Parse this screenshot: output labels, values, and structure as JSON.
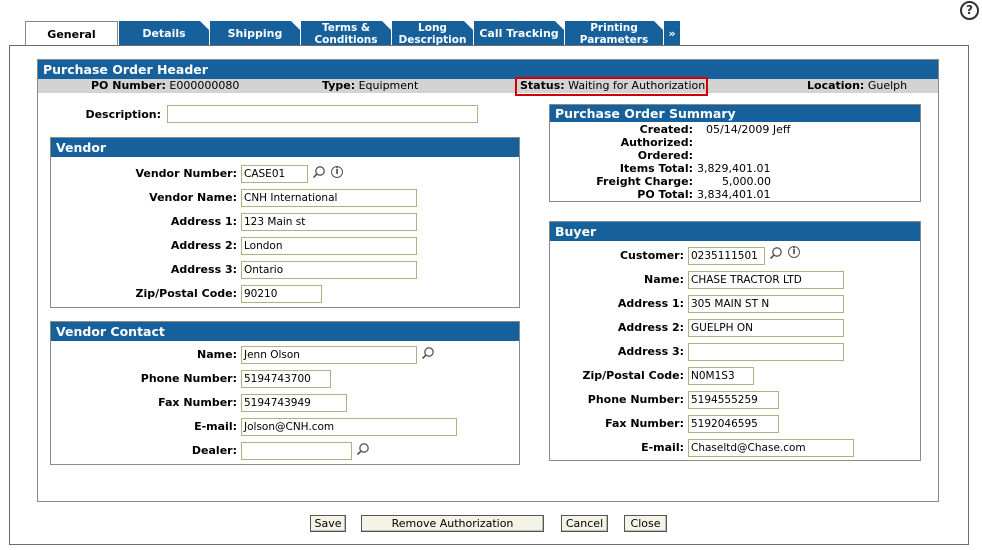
{
  "help_symbol": "?",
  "tabs": [
    {
      "l1": "General",
      "l2": ""
    },
    {
      "l1": "Details",
      "l2": ""
    },
    {
      "l1": "Shipping",
      "l2": ""
    },
    {
      "l1": "Terms &",
      "l2": "Conditions"
    },
    {
      "l1": "Long",
      "l2": "Description"
    },
    {
      "l1": "Call Tracking",
      "l2": ""
    },
    {
      "l1": "Printing",
      "l2": "Parameters"
    },
    {
      "l1": "»",
      "l2": ""
    }
  ],
  "header": {
    "title": "Purchase Order Header",
    "po_label": "PO Number:",
    "po_value": "E000000080",
    "type_label": "Type:",
    "type_value": "Equipment",
    "status_label": "Status:",
    "status_value": "Waiting for Authorization",
    "location_label": "Location:",
    "location_value": "Guelph"
  },
  "description": {
    "label": "Description:",
    "value": ""
  },
  "vendor": {
    "title": "Vendor",
    "number_label": "Vendor Number:",
    "number_value": "CASE01",
    "name_label": "Vendor Name:",
    "name_value": "CNH International",
    "addr1_label": "Address 1:",
    "addr1_value": "123 Main st",
    "addr2_label": "Address 2:",
    "addr2_value": "London",
    "addr3_label": "Address 3:",
    "addr3_value": "Ontario",
    "zip_label": "Zip/Postal Code:",
    "zip_value": "90210"
  },
  "vendor_contact": {
    "title": "Vendor Contact",
    "name_label": "Name:",
    "name_value": "Jenn Olson",
    "phone_label": "Phone Number:",
    "phone_value": "5194743700",
    "fax_label": "Fax Number:",
    "fax_value": "5194743949",
    "email_label": "E-mail:",
    "email_value": "Jolson@CNH.com",
    "dealer_label": "Dealer:",
    "dealer_value": ""
  },
  "summary": {
    "title": "Purchase Order Summary",
    "created_label": "Created:",
    "created_value": "05/14/2009 Jeff",
    "authorized_label": "Authorized:",
    "authorized_value": "",
    "ordered_label": "Ordered:",
    "ordered_value": "",
    "items_label": "Items Total:",
    "items_value": "3,829,401.01",
    "freight_label": "Freight Charge:",
    "freight_value": "5,000.00",
    "total_label": "PO Total:",
    "total_value": "3,834,401.01"
  },
  "buyer": {
    "title": "Buyer",
    "customer_label": "Customer:",
    "customer_value": "0235111501",
    "name_label": "Name:",
    "name_value": "CHASE TRACTOR LTD",
    "addr1_label": "Address 1:",
    "addr1_value": "305 MAIN ST N",
    "addr2_label": "Address 2:",
    "addr2_value": "GUELPH ON",
    "addr3_label": "Address 3:",
    "addr3_value": "",
    "zip_label": "Zip/Postal Code:",
    "zip_value": "N0M1S3",
    "phone_label": "Phone Number:",
    "phone_value": "5194555259",
    "fax_label": "Fax Number:",
    "fax_value": "5192046595",
    "email_label": "E-mail:",
    "email_value": "Chaseltd@Chase.com"
  },
  "buttons": {
    "save": "Save",
    "remove_auth": "Remove Authorization",
    "cancel": "Cancel",
    "close": "Close"
  },
  "colors": {
    "header_blue": "#16609c",
    "status_highlight": "#d00000",
    "field_border": "#a8b483"
  }
}
